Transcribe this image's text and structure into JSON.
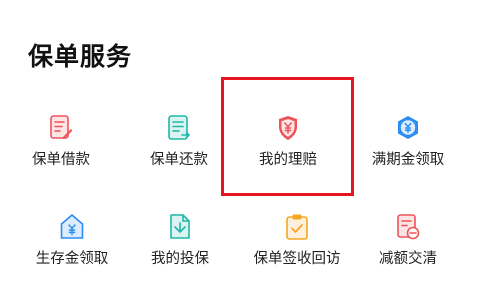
{
  "section": {
    "title": "保单服务"
  },
  "services": [
    {
      "label": "保单借款",
      "icon": "document-edit-icon",
      "color": "#f0525a"
    },
    {
      "label": "保单还款",
      "icon": "document-list-icon",
      "color": "#1fb8a6"
    },
    {
      "label": "我的理赔",
      "icon": "yuan-shield-icon",
      "color": "#f0525a"
    },
    {
      "label": "满期金领取",
      "icon": "yuan-hexagon-icon",
      "color": "#2c8ef0"
    },
    {
      "label": "生存金领取",
      "icon": "yuan-house-icon",
      "color": "#2c8ef0"
    },
    {
      "label": "我的投保",
      "icon": "document-download-icon",
      "color": "#1fb8a6"
    },
    {
      "label": "保单签收回访",
      "icon": "clipboard-check-icon",
      "color": "#f5a623"
    },
    {
      "label": "减额交清",
      "icon": "document-minus-icon",
      "color": "#f0525a"
    }
  ],
  "highlight": {
    "color": "#e8141e",
    "target": "我的理赔"
  }
}
